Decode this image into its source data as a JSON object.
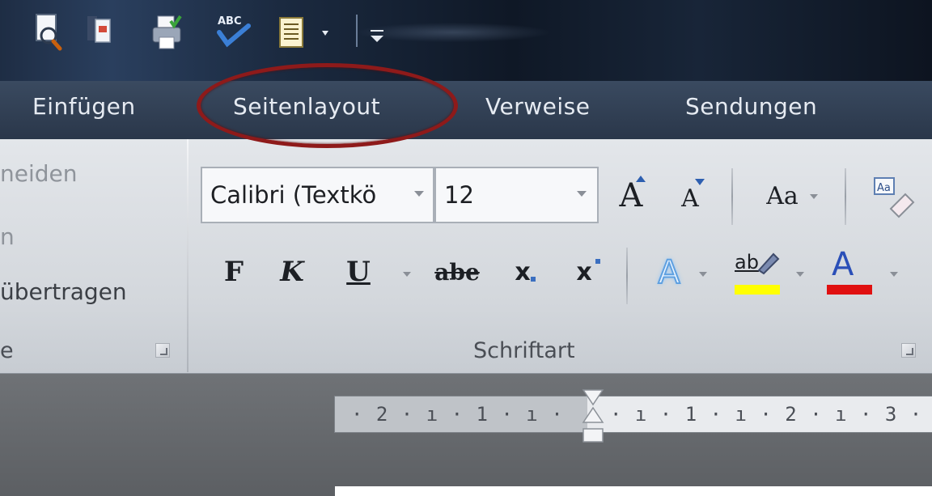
{
  "quick_access": {
    "icons": [
      "print-preview-icon",
      "document-icon",
      "print-icon",
      "spelling-icon",
      "list-document-icon",
      "customize-toolbar-icon"
    ]
  },
  "tabs": [
    {
      "label": "Einfügen"
    },
    {
      "label": "Seitenlayout"
    },
    {
      "label": "Verweise"
    },
    {
      "label": "Sendungen"
    }
  ],
  "clipboard": {
    "cut_partial": "neiden",
    "copy_partial": "n",
    "format_painter_partial": "übertragen",
    "group_label_partial": "e"
  },
  "font_group": {
    "font_name": "Calibri (Textkö",
    "font_size": "12",
    "grow_label": "A",
    "shrink_label": "A",
    "change_case_label": "Aa",
    "bold_label": "F",
    "italic_label": "K",
    "underline_label": "U",
    "strike_label": "abe",
    "subscript_label": "x",
    "superscript_label": "x",
    "text_effects_label": "A",
    "highlight_label": "ab",
    "font_color_label": "A",
    "group_label": "Schriftart"
  },
  "ruler": {
    "left_text": "· 2 · ı · 1 · ı ·",
    "right_text": "· ı · 1 · ı · 2 · ı · 3 ·"
  },
  "colors": {
    "highlight_yellow": "#ffff00",
    "font_red": "#e01010",
    "annotation_ring": "#8e1a1a"
  }
}
